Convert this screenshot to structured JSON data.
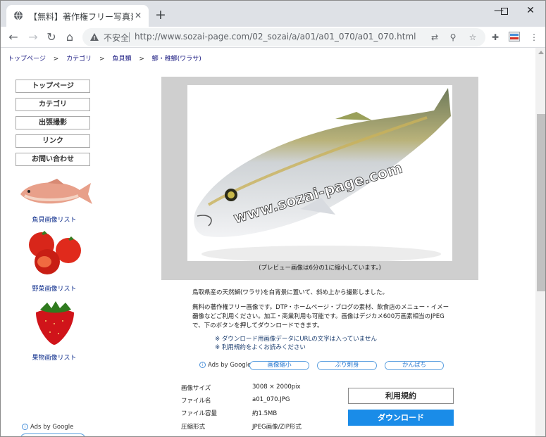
{
  "browser": {
    "tab_title": "【無料】著作権フリー写真素材",
    "insecure_label": "不安全",
    "url": "http://www.sozai-page.com/02_sozai/a/a01/a01_070/a01_070.html"
  },
  "breadcrumb": [
    "トップページ",
    "カテゴリ",
    "魚貝類",
    "鰤・稚鰤(ワラサ)"
  ],
  "breadcrumb_sep": ">",
  "side_menu": [
    "トップページ",
    "カテゴリ",
    "出張撮影",
    "リンク",
    "お問い合わせ"
  ],
  "side_thumbs": {
    "fish": "魚貝画像リスト",
    "vegetables": "野菜画像リスト",
    "fruit": "果物画像リスト"
  },
  "preview": {
    "watermark": "www.sozai-page.com",
    "caption": "(プレビュー画像は6分の1に縮小しています。)"
  },
  "description": "鳥取県産の天然鰤(ワラサ)を白背景に置いて、斜め上から撮影しました。",
  "usage": {
    "line1": "無料の著作権フリー画像です。DTP・ホームページ・ブログの素材、飲食店のメニュー・イメージ",
    "line2": "画像などご利用ください。加工・商業利用も可能です。画像はデジカメ600万画素相当のJPEG",
    "line3": "で、下のボタンを押してダウンロードできます。"
  },
  "notes": [
    "※ ダウンロード用画像データにURLの文字は入っていません",
    "※ 利用規約をよくお読みください"
  ],
  "ads": {
    "label": "Ads by Google",
    "links": [
      "画像縮小",
      "ぶり刺身",
      "かんぱち"
    ]
  },
  "info": {
    "size_label": "画像サイズ",
    "size_value": "3008 × 2000pix",
    "filename_label": "ファイル名",
    "filename_value": "a01_070.JPG",
    "filesize_label": "ファイル容量",
    "filesize_value": "約1.5MB",
    "format_label": "圧縮形式",
    "format_value": "JPEG画像/ZIP形式"
  },
  "buttons": {
    "terms": "利用規約",
    "download": "ダウンロード"
  },
  "colors": {
    "download_bg": "#1a8ce8",
    "link_blue": "#1a1a80",
    "preview_bg": "#cfcfcf"
  }
}
